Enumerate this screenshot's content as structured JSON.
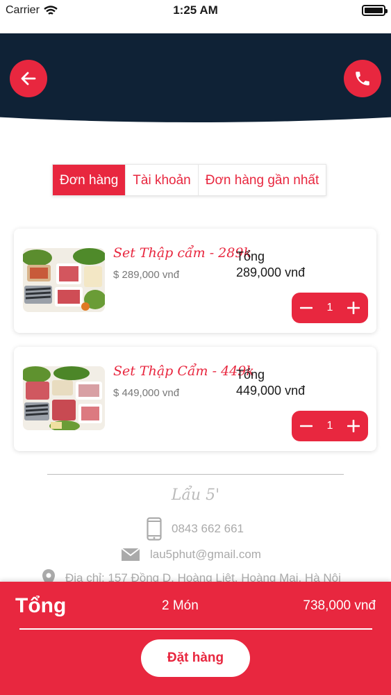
{
  "status_bar": {
    "carrier": "Carrier",
    "time": "1:25 AM"
  },
  "header": {
    "back_icon": "arrow-left-icon",
    "call_icon": "phone-icon"
  },
  "tabs": [
    {
      "label": "Đơn hàng",
      "active": true
    },
    {
      "label": "Tài khoản",
      "active": false
    },
    {
      "label": "Đơn hàng gần nhất",
      "active": false
    }
  ],
  "cart_items": [
    {
      "name": "Set Thập cẩm - 289k",
      "price": "$ 289,000 vnđ",
      "total_label": "Tổng",
      "total_value": "289,000 vnđ",
      "quantity": "1"
    },
    {
      "name": "Set Thập Cẩm - 449k",
      "price": "$ 449,000 vnđ",
      "total_label": "Tổng",
      "total_value": "449,000 vnđ",
      "quantity": "1"
    }
  ],
  "footer_info": {
    "brand": "Lẩu 5'",
    "phone": "0843 662 661",
    "email": "lau5phut@gmail.com",
    "address": "Địa chỉ: 157 Đồng D. Hoàng Liệt, Hoàng Mai, Hà Nội"
  },
  "summary": {
    "title": "Tổng",
    "item_count": "2 Món",
    "total": "738,000 vnđ",
    "order_button": "Đặt hàng"
  },
  "colors": {
    "accent": "#e8273f",
    "header_bg": "#0f2236"
  }
}
